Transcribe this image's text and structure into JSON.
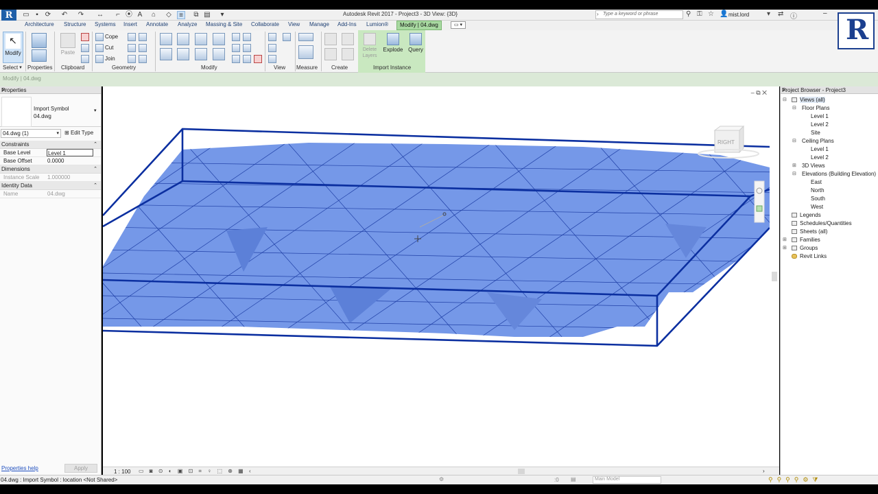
{
  "app": {
    "logo_letter": "R",
    "window_title": "Autodesk Revit 2017 -    Project3 - 3D View: {3D}",
    "search_placeholder": "Type a keyword or phrase",
    "user": "mist.lord"
  },
  "tabs": [
    "Architecture",
    "Structure",
    "Systems",
    "Insert",
    "Annotate",
    "Analyze",
    "Massing & Site",
    "Collaborate",
    "View",
    "Manage",
    "Add-Ins",
    "Lumion®",
    "Modify | 04.dwg"
  ],
  "ribbon": {
    "select_label": "Select",
    "modify_label": "Modify",
    "properties_label": "Properties",
    "clipboard_label": "Clipboard",
    "paste_label": "Paste",
    "cope_label": "Cope",
    "cut_label": "Cut",
    "join_label": "Join",
    "geometry_label": "Geometry",
    "modify_panel_label": "Modify",
    "view_label": "View",
    "measure_label": "Measure",
    "create_label": "Create",
    "delete_layers_label": "Delete Layers",
    "explode_label": "Explode",
    "query_label": "Query",
    "import_instance_label": "Import Instance"
  },
  "context_line": "Modify | 04.dwg",
  "properties": {
    "title": "Properties",
    "type_line1": "Import Symbol",
    "type_line2": "04.dwg",
    "instance_selector": "04.dwg (1)",
    "edit_type": "Edit Type",
    "groups": [
      {
        "name": "Constraints",
        "rows": [
          {
            "key": "Base Level",
            "value": "Level 1"
          },
          {
            "key": "Base Offset",
            "value": "0.0000"
          }
        ]
      },
      {
        "name": "Dimensions",
        "rows": [
          {
            "key": "Instance Scale",
            "value": "1.000000"
          }
        ]
      },
      {
        "name": "Identity Data",
        "rows": [
          {
            "key": "Name",
            "value": "04.dwg"
          }
        ]
      }
    ],
    "help": "Properties help",
    "apply": "Apply"
  },
  "viewcube_label": "RIGHT",
  "view_scale": "1 : 100",
  "browser": {
    "title": "Project Browser - Project3",
    "items": [
      {
        "label": "Views (all)"
      },
      {
        "label": "Floor Plans"
      },
      {
        "label": "Level 1"
      },
      {
        "label": "Level 2"
      },
      {
        "label": "Site"
      },
      {
        "label": "Ceiling Plans"
      },
      {
        "label": "Level 1"
      },
      {
        "label": "Level 2"
      },
      {
        "label": "3D Views"
      },
      {
        "label": "Elevations (Building Elevation)"
      },
      {
        "label": "East"
      },
      {
        "label": "North"
      },
      {
        "label": "South"
      },
      {
        "label": "West"
      },
      {
        "label": "Legends"
      },
      {
        "label": "Schedules/Quantities"
      },
      {
        "label": "Sheets (all)"
      },
      {
        "label": "Families"
      },
      {
        "label": "Groups"
      },
      {
        "label": "Revit Links"
      }
    ]
  },
  "status": {
    "text": "04.dwg : Import Symbol : location <Not Shared>",
    "zero": ":0",
    "workset": "Main Model"
  },
  "colors": {
    "surface": "#6f93e6",
    "bbox": "#0b2fa0",
    "ribbon_context": "#c9e8c0"
  }
}
